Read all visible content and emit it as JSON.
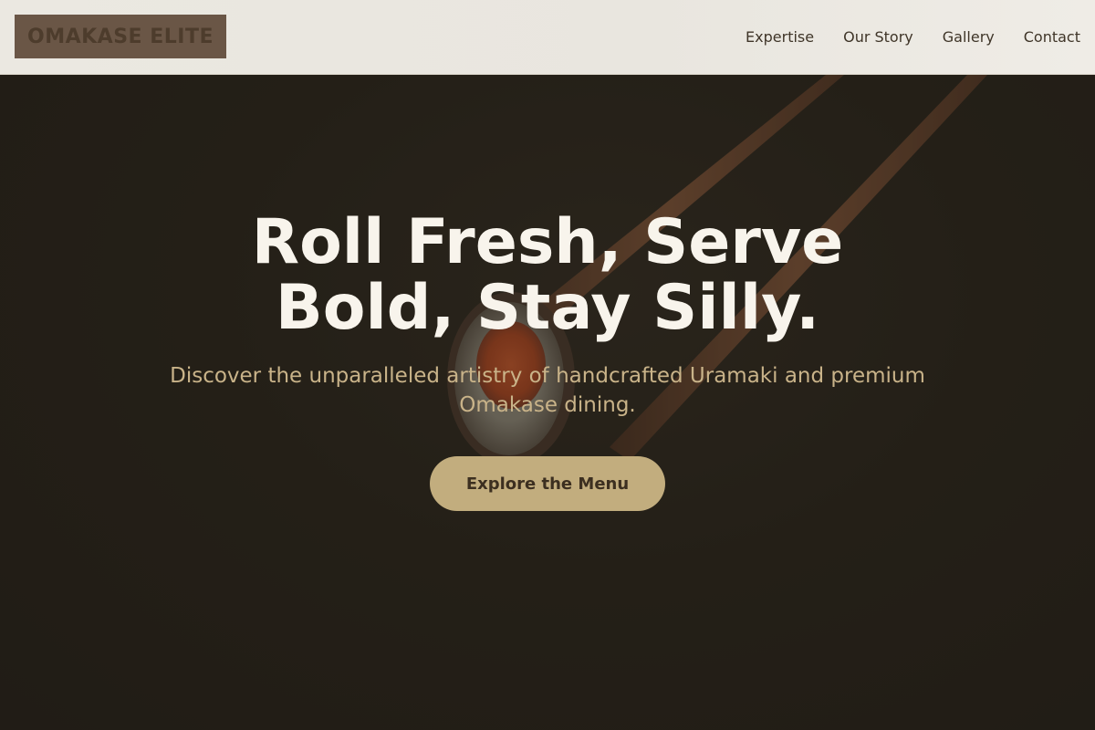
{
  "brand": {
    "logo_text": "OMAKASE ELITE"
  },
  "nav": {
    "items": [
      {
        "label": "Expertise"
      },
      {
        "label": "Our Story"
      },
      {
        "label": "Gallery"
      },
      {
        "label": "Contact"
      }
    ]
  },
  "hero": {
    "title": "Roll Fresh, Serve Bold, Stay Silly.",
    "subtitle": "Discover the unparalleled artistry of handcrafted Uramaki and premium Omakase dining.",
    "cta_label": "Explore the Menu",
    "background_image": "sushi-roll-held-by-chopsticks"
  },
  "colors": {
    "header_bg": "#ebe8e1",
    "logo_bg": "#6a5646",
    "hero_bg": "#26221a",
    "title": "#f8f4ec",
    "subtitle": "#c9b389",
    "cta_bg": "#c2ad7e",
    "cta_text": "#3c2f20"
  }
}
